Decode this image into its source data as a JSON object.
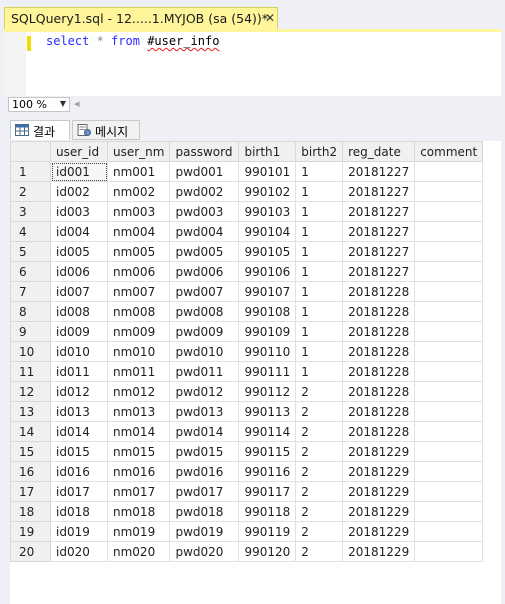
{
  "tab": {
    "title": "SQLQuery1.sql - 12.....1.MYJOB (sa (54))*",
    "close_glyph": "✕"
  },
  "editor": {
    "kw_select": "select",
    "star": "*",
    "kw_from": "from",
    "table_name": "#user_info"
  },
  "zoom": {
    "value": "100 %",
    "arrow": "▼",
    "scroll_left": "◂"
  },
  "result_tabs": [
    {
      "label": "결과",
      "active": true
    },
    {
      "label": "메시지",
      "active": false
    }
  ],
  "grid": {
    "columns": [
      "",
      "user_id",
      "user_nm",
      "password",
      "birth1",
      "birth2",
      "reg_date",
      "comment"
    ],
    "rows": [
      [
        "1",
        "id001",
        "nm001",
        "pwd001",
        "990101",
        "1",
        "20181227",
        ""
      ],
      [
        "2",
        "id002",
        "nm002",
        "pwd002",
        "990102",
        "1",
        "20181227",
        ""
      ],
      [
        "3",
        "id003",
        "nm003",
        "pwd003",
        "990103",
        "1",
        "20181227",
        ""
      ],
      [
        "4",
        "id004",
        "nm004",
        "pwd004",
        "990104",
        "1",
        "20181227",
        ""
      ],
      [
        "5",
        "id005",
        "nm005",
        "pwd005",
        "990105",
        "1",
        "20181227",
        ""
      ],
      [
        "6",
        "id006",
        "nm006",
        "pwd006",
        "990106",
        "1",
        "20181227",
        ""
      ],
      [
        "7",
        "id007",
        "nm007",
        "pwd007",
        "990107",
        "1",
        "20181228",
        ""
      ],
      [
        "8",
        "id008",
        "nm008",
        "pwd008",
        "990108",
        "1",
        "20181228",
        ""
      ],
      [
        "9",
        "id009",
        "nm009",
        "pwd009",
        "990109",
        "1",
        "20181228",
        ""
      ],
      [
        "10",
        "id010",
        "nm010",
        "pwd010",
        "990110",
        "1",
        "20181228",
        ""
      ],
      [
        "11",
        "id011",
        "nm011",
        "pwd011",
        "990111",
        "1",
        "20181228",
        ""
      ],
      [
        "12",
        "id012",
        "nm012",
        "pwd012",
        "990112",
        "2",
        "20181228",
        ""
      ],
      [
        "13",
        "id013",
        "nm013",
        "pwd013",
        "990113",
        "2",
        "20181228",
        ""
      ],
      [
        "14",
        "id014",
        "nm014",
        "pwd014",
        "990114",
        "2",
        "20181228",
        ""
      ],
      [
        "15",
        "id015",
        "nm015",
        "pwd015",
        "990115",
        "2",
        "20181229",
        ""
      ],
      [
        "16",
        "id016",
        "nm016",
        "pwd016",
        "990116",
        "2",
        "20181229",
        ""
      ],
      [
        "17",
        "id017",
        "nm017",
        "pwd017",
        "990117",
        "2",
        "20181229",
        ""
      ],
      [
        "18",
        "id018",
        "nm018",
        "pwd018",
        "990118",
        "2",
        "20181229",
        ""
      ],
      [
        "19",
        "id019",
        "nm019",
        "pwd019",
        "990119",
        "2",
        "20181229",
        ""
      ],
      [
        "20",
        "id020",
        "nm020",
        "pwd020",
        "990120",
        "2",
        "20181229",
        ""
      ]
    ]
  }
}
